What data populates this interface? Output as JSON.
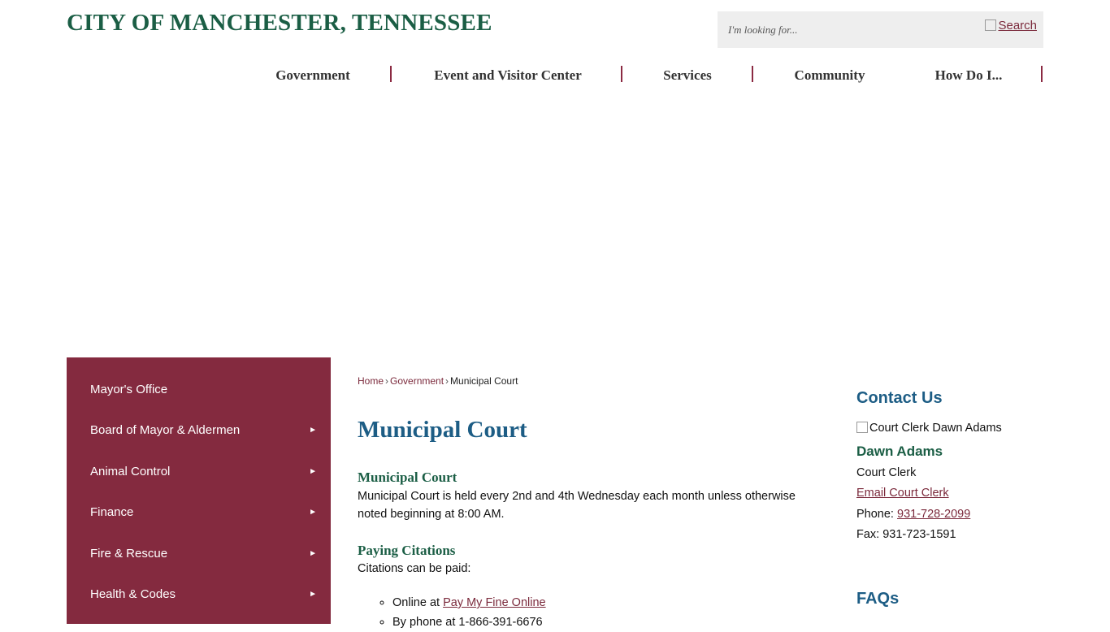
{
  "header": {
    "site_title": "CITY OF MANCHESTER, TENNESSEE",
    "search": {
      "placeholder": "I'm looking for...",
      "button_label": "Search"
    }
  },
  "nav": {
    "items": [
      {
        "label": "Government"
      },
      {
        "label": "Event and Visitor Center"
      },
      {
        "label": "Services"
      },
      {
        "label": "Community"
      },
      {
        "label": "How Do I..."
      }
    ]
  },
  "sidebar": {
    "items": [
      {
        "label": "Mayor's Office",
        "has_submenu": false
      },
      {
        "label": "Board of Mayor & Aldermen",
        "has_submenu": true
      },
      {
        "label": "Animal Control",
        "has_submenu": true
      },
      {
        "label": "Finance",
        "has_submenu": true
      },
      {
        "label": "Fire & Rescue",
        "has_submenu": true
      },
      {
        "label": "Health & Codes",
        "has_submenu": true
      }
    ],
    "arrow_glyph": "►"
  },
  "breadcrumb": {
    "home": "Home",
    "section": "Government",
    "current": "Municipal Court",
    "separator": "›"
  },
  "main": {
    "title": "Municipal Court",
    "section1": {
      "heading": "Municipal Court",
      "text": "Municipal Court is held every 2nd and 4th Wednesday each month unless otherwise noted beginning at 8:00 AM."
    },
    "section2": {
      "heading": "Paying Citations",
      "text": "Citations can be paid:",
      "options": [
        {
          "prefix": "Online at ",
          "link": "Pay My Fine Online"
        },
        {
          "prefix": "By phone at 1-866-391-6676",
          "link": ""
        }
      ]
    }
  },
  "contact": {
    "title": "Contact Us",
    "photo_alt": "Court Clerk Dawn Adams",
    "name": "Dawn Adams",
    "role": "Court Clerk",
    "email_label": "Email Court Clerk",
    "phone_label": "Phone: ",
    "phone": "931-728-2099",
    "fax": "Fax: 931-723-1591"
  },
  "faqs": {
    "title": "FAQs"
  },
  "colors": {
    "brand_green": "#1b5e45",
    "sidebar_maroon": "#842a3f",
    "link_maroon": "#7b2a3c",
    "heading_blue": "#1d5d85"
  }
}
